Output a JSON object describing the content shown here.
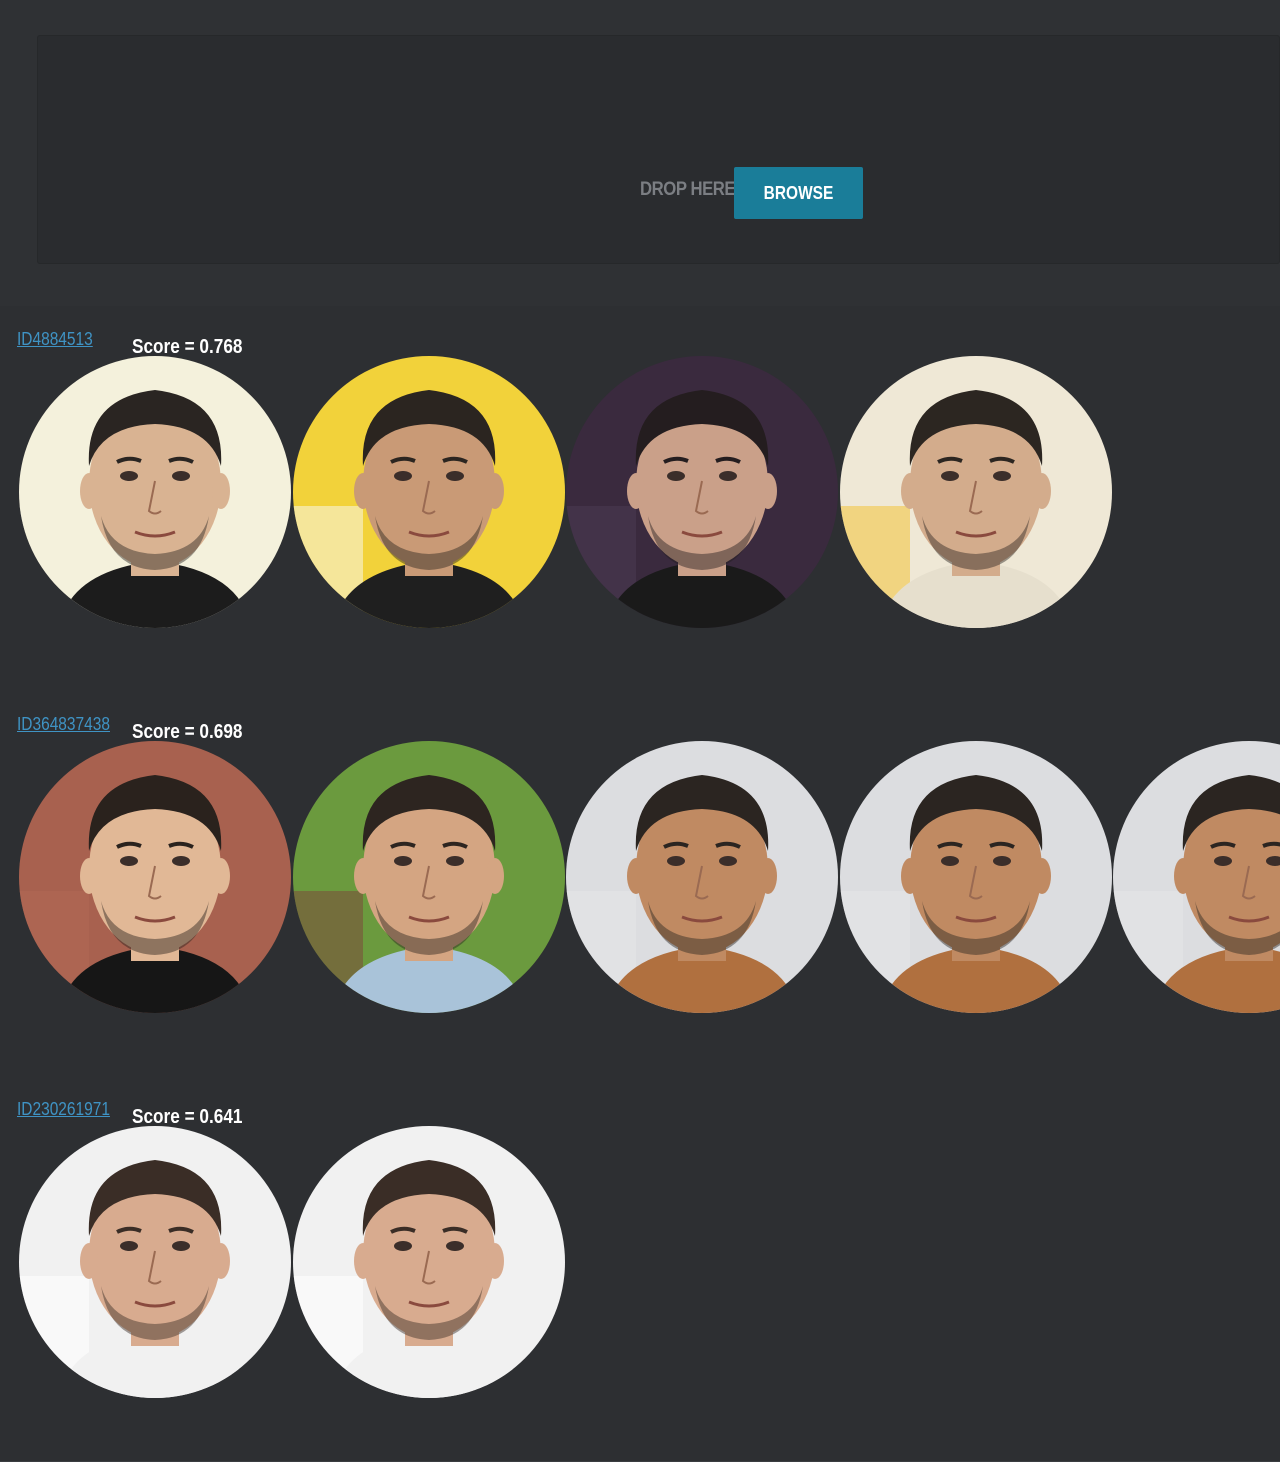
{
  "upload": {
    "drop_label": "DROP HERE",
    "browse_label": "BROWSE"
  },
  "results": [
    {
      "id": "ID4884513",
      "score": "Score = 0.768",
      "photos": [
        {
          "bg": "#f4f1dc",
          "skin": "#d9b392",
          "hair": "#2a2522",
          "shirt": "#1c1c1c",
          "accent": "#f4f1dc"
        },
        {
          "bg": "#f2d23a",
          "skin": "#c99a76",
          "hair": "#2b2520",
          "shirt": "#1f1f1f",
          "accent": "#f8f5ea"
        },
        {
          "bg": "#3a2a3e",
          "skin": "#caa089",
          "hair": "#241d1f",
          "shirt": "#1a1a1a",
          "accent": "#4a3a52"
        },
        {
          "bg": "#efe8d6",
          "skin": "#d3ac8c",
          "hair": "#2c2621",
          "shirt": "#e6dfcd",
          "accent": "#f2c23a"
        }
      ]
    },
    {
      "id": "ID364837438",
      "score": "Score = 0.698",
      "photos": [
        {
          "bg": "#a8614f",
          "skin": "#e1b896",
          "hair": "#2a221d",
          "shirt": "#161616",
          "accent": "#b06a56"
        },
        {
          "bg": "#6b9a3e",
          "skin": "#d4a582",
          "hair": "#2d2520",
          "shirt": "#a9c3d9",
          "accent": "#7b4a3a"
        },
        {
          "bg": "#dcdde0",
          "skin": "#c08a62",
          "hair": "#2b2521",
          "shirt": "#b0703f",
          "accent": "#e6e6e8"
        },
        {
          "bg": "#dcdde0",
          "skin": "#c08a62",
          "hair": "#2b2521",
          "shirt": "#b0703f",
          "accent": "#e6e6e8"
        },
        {
          "bg": "#dcdde0",
          "skin": "#c08a62",
          "hair": "#2b2521",
          "shirt": "#b0703f",
          "accent": "#e6e6e8"
        }
      ]
    },
    {
      "id": "ID230261971",
      "score": "Score = 0.641",
      "photos": [
        {
          "bg": "#f1f1f1",
          "skin": "#d8ab8f",
          "hair": "#3a2d26",
          "shirt": "#f1f1f1",
          "accent": "#ffffff"
        },
        {
          "bg": "#f1f1f1",
          "skin": "#d8ab8f",
          "hair": "#3a2d26",
          "shirt": "#f1f1f1",
          "accent": "#ffffff"
        }
      ]
    }
  ]
}
